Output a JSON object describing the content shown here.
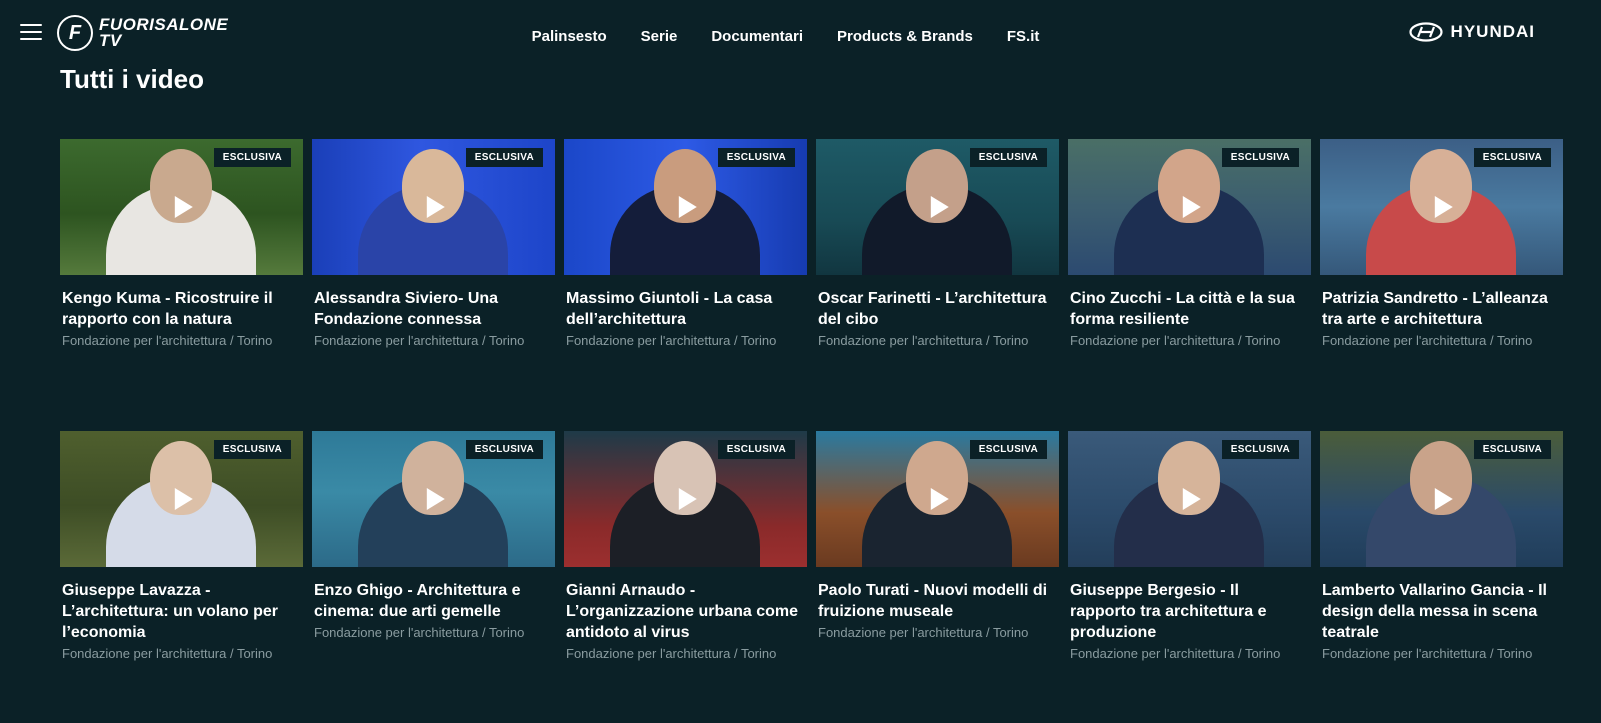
{
  "header": {
    "logo_line1": "FUORISALONE",
    "logo_line2": "TV",
    "logo_mark": "F",
    "nav": [
      "Palinsesto",
      "Serie",
      "Documentari",
      "Products & Brands",
      "FS.it"
    ],
    "sponsor": "HYUNDAI",
    "menu_icon": "hamburger-menu-icon"
  },
  "section": {
    "title": "Tutti i video"
  },
  "badge_label": "ESCLUSIVA",
  "videos": [
    {
      "title": "Kengo Kuma - Ricostruire il rapporto con la natura",
      "subtitle": "Fondazione per l'architettura / Torino"
    },
    {
      "title": "Alessandra Siviero- Una Fondazione connessa",
      "subtitle": "Fondazione per l'architettura / Torino"
    },
    {
      "title": "Massimo Giuntoli - La casa dell’architettura",
      "subtitle": "Fondazione per l'architettura / Torino"
    },
    {
      "title": "Oscar Farinetti - L’architettura del cibo",
      "subtitle": "Fondazione per l'architettura / Torino"
    },
    {
      "title": "Cino Zucchi - La città e la sua forma resiliente",
      "subtitle": "Fondazione per l'architettura / Torino"
    },
    {
      "title": "Patrizia Sandretto - L’alleanza tra arte e architettura",
      "subtitle": "Fondazione per l'architettura / Torino"
    },
    {
      "title": "Giuseppe Lavazza - L’architettura: un volano per l’economia",
      "subtitle": "Fondazione per l'architettura / Torino"
    },
    {
      "title": "Enzo Ghigo - Architettura e cinema: due arti gemelle",
      "subtitle": "Fondazione per l'architettura / Torino"
    },
    {
      "title": "Gianni Arnaudo - L’organizzazione urbana come antidoto al virus",
      "subtitle": "Fondazione per l'architettura / Torino"
    },
    {
      "title": "Paolo Turati - Nuovi modelli di fruizione museale",
      "subtitle": "Fondazione per l'architettura / Torino"
    },
    {
      "title": "Giuseppe Bergesio - Il rapporto tra architettura e produzione",
      "subtitle": "Fondazione per l'architettura / Torino"
    },
    {
      "title": "Lamberto Vallarino Gancia - Il design della messa in scena teatrale",
      "subtitle": "Fondazione per l'architettura / Torino"
    }
  ],
  "colors": {
    "background": "#0b2127",
    "subtitle": "#8a9ca0",
    "badge_bg": "#0b2127"
  }
}
